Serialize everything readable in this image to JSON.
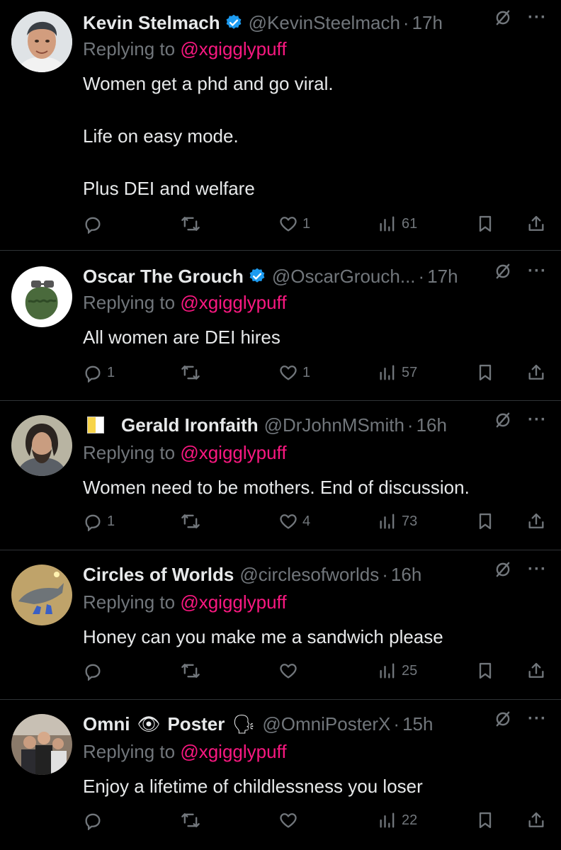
{
  "replies": [
    {
      "name": "Kevin Stelmach",
      "handle": "@KevinSteelmach",
      "time": "17h",
      "reply_prefix": "Replying to",
      "reply_to": "@xgigglypuff",
      "text": "Women get a phd and go viral.\n\nLife on easy mode.\n\nPlus DEI and welfare",
      "replies": "",
      "reposts": "",
      "likes": "1",
      "views": "61"
    },
    {
      "name": "Oscar The Grouch",
      "handle": "@OscarGrouch...",
      "time": "17h",
      "reply_prefix": "Replying to",
      "reply_to": "@xgigglypuff",
      "text": "All women are DEI hires",
      "replies": "1",
      "reposts": "",
      "likes": "1",
      "views": "57"
    },
    {
      "name": "Gerald Ironfaith",
      "handle": "@DrJohnMSmith",
      "time": "16h",
      "reply_prefix": "Replying to",
      "reply_to": "@xgigglypuff",
      "text": "Women need to be mothers. End of discussion.",
      "replies": "1",
      "reposts": "",
      "likes": "4",
      "views": "73"
    },
    {
      "name": "Circles of Worlds",
      "handle": "@circlesofworlds",
      "time": "16h",
      "reply_prefix": "Replying to",
      "reply_to": "@xgigglypuff",
      "text": "Honey can you make me a sandwich please",
      "replies": "",
      "reposts": "",
      "likes": "",
      "views": "25"
    },
    {
      "name_part1": "Omni",
      "name_emoji": "👁",
      "name_part2": "Poster",
      "name_emoji2": "🗣",
      "handle": "@OmniPosterX",
      "time": "15h",
      "reply_prefix": "Replying to",
      "reply_to": "@xgigglypuff",
      "text": "Enjoy a lifetime of childlessness you loser",
      "replies": "",
      "reposts": "",
      "likes": "",
      "views": "22"
    }
  ],
  "colors": {
    "background": "#000000",
    "text": "#e7e9ea",
    "muted": "#71767b",
    "mention": "#f91880",
    "verified": "#1d9bf0",
    "divider": "#2f3336"
  },
  "icons": [
    "reply-icon",
    "repost-icon",
    "like-icon",
    "views-icon",
    "bookmark-icon",
    "share-icon",
    "grok-icon",
    "more-icon",
    "verified-icon"
  ]
}
